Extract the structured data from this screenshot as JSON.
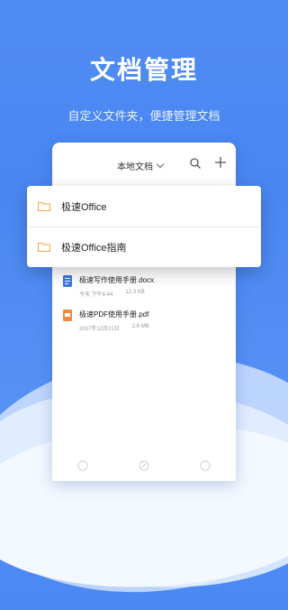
{
  "hero": {
    "title": "文档管理",
    "subtitle": "自定义文件夹，便捷管理文档"
  },
  "header": {
    "location_label": "本地文档"
  },
  "folders": [
    {
      "label": "极速Office"
    },
    {
      "label": "极速Office指南"
    }
  ],
  "documents": [
    {
      "name": "极速写作使用手册.docx",
      "time": "今天 下午6:44",
      "size": "12.3 KB",
      "icon": "word-file-icon",
      "color": "#3a7be0"
    },
    {
      "name": "极速PDF使用手册.pdf",
      "time": "2017年12月21日",
      "size": "2.6 MB",
      "icon": "pdf-file-icon",
      "color": "#f08a3c"
    }
  ],
  "colors": {
    "accent": "#4f8cf3",
    "folder": "#f2a93b"
  }
}
